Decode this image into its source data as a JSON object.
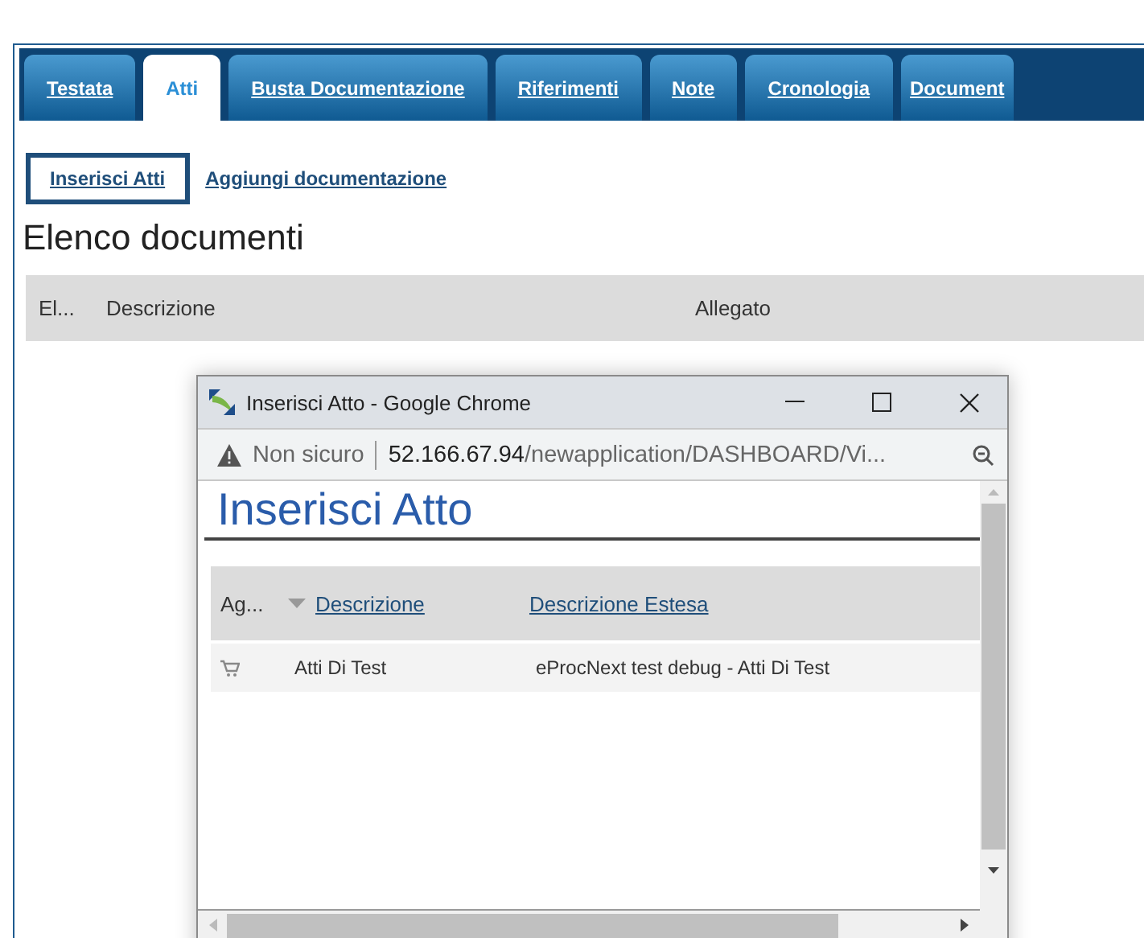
{
  "tabs": [
    {
      "label": "Testata",
      "selected": false
    },
    {
      "label": "Atti",
      "selected": true
    },
    {
      "label": "Busta Documentazione",
      "selected": false
    },
    {
      "label": "Riferimenti",
      "selected": false
    },
    {
      "label": "Note",
      "selected": false
    },
    {
      "label": "Cronologia",
      "selected": false
    },
    {
      "label": "Document",
      "selected": false
    }
  ],
  "actions": [
    {
      "label": "Inserisci Atti",
      "selected": true
    },
    {
      "label": "Aggiungi documentazione",
      "selected": false
    }
  ],
  "heading": "Elenco documenti",
  "table": {
    "columns": [
      "El...",
      "Descrizione",
      "Allegato"
    ]
  },
  "popup": {
    "title": "Inserisci Atto - Google Chrome",
    "security": "Non sicuro",
    "url": {
      "host": "52.166.67.94",
      "path": "/newapplication/DASHBOARD/Vi..."
    },
    "heading": "Inserisci Atto",
    "columns": [
      {
        "label": "Ag...",
        "kind": "text",
        "sorted": false
      },
      {
        "label": "Descrizione",
        "kind": "link",
        "sorted": true
      },
      {
        "label": "Descrizione Estesa",
        "kind": "link",
        "sorted": false
      }
    ],
    "rows": [
      {
        "description": "Atti Di Test",
        "extended": "eProcNext test debug - Atti Di Test"
      }
    ]
  }
}
